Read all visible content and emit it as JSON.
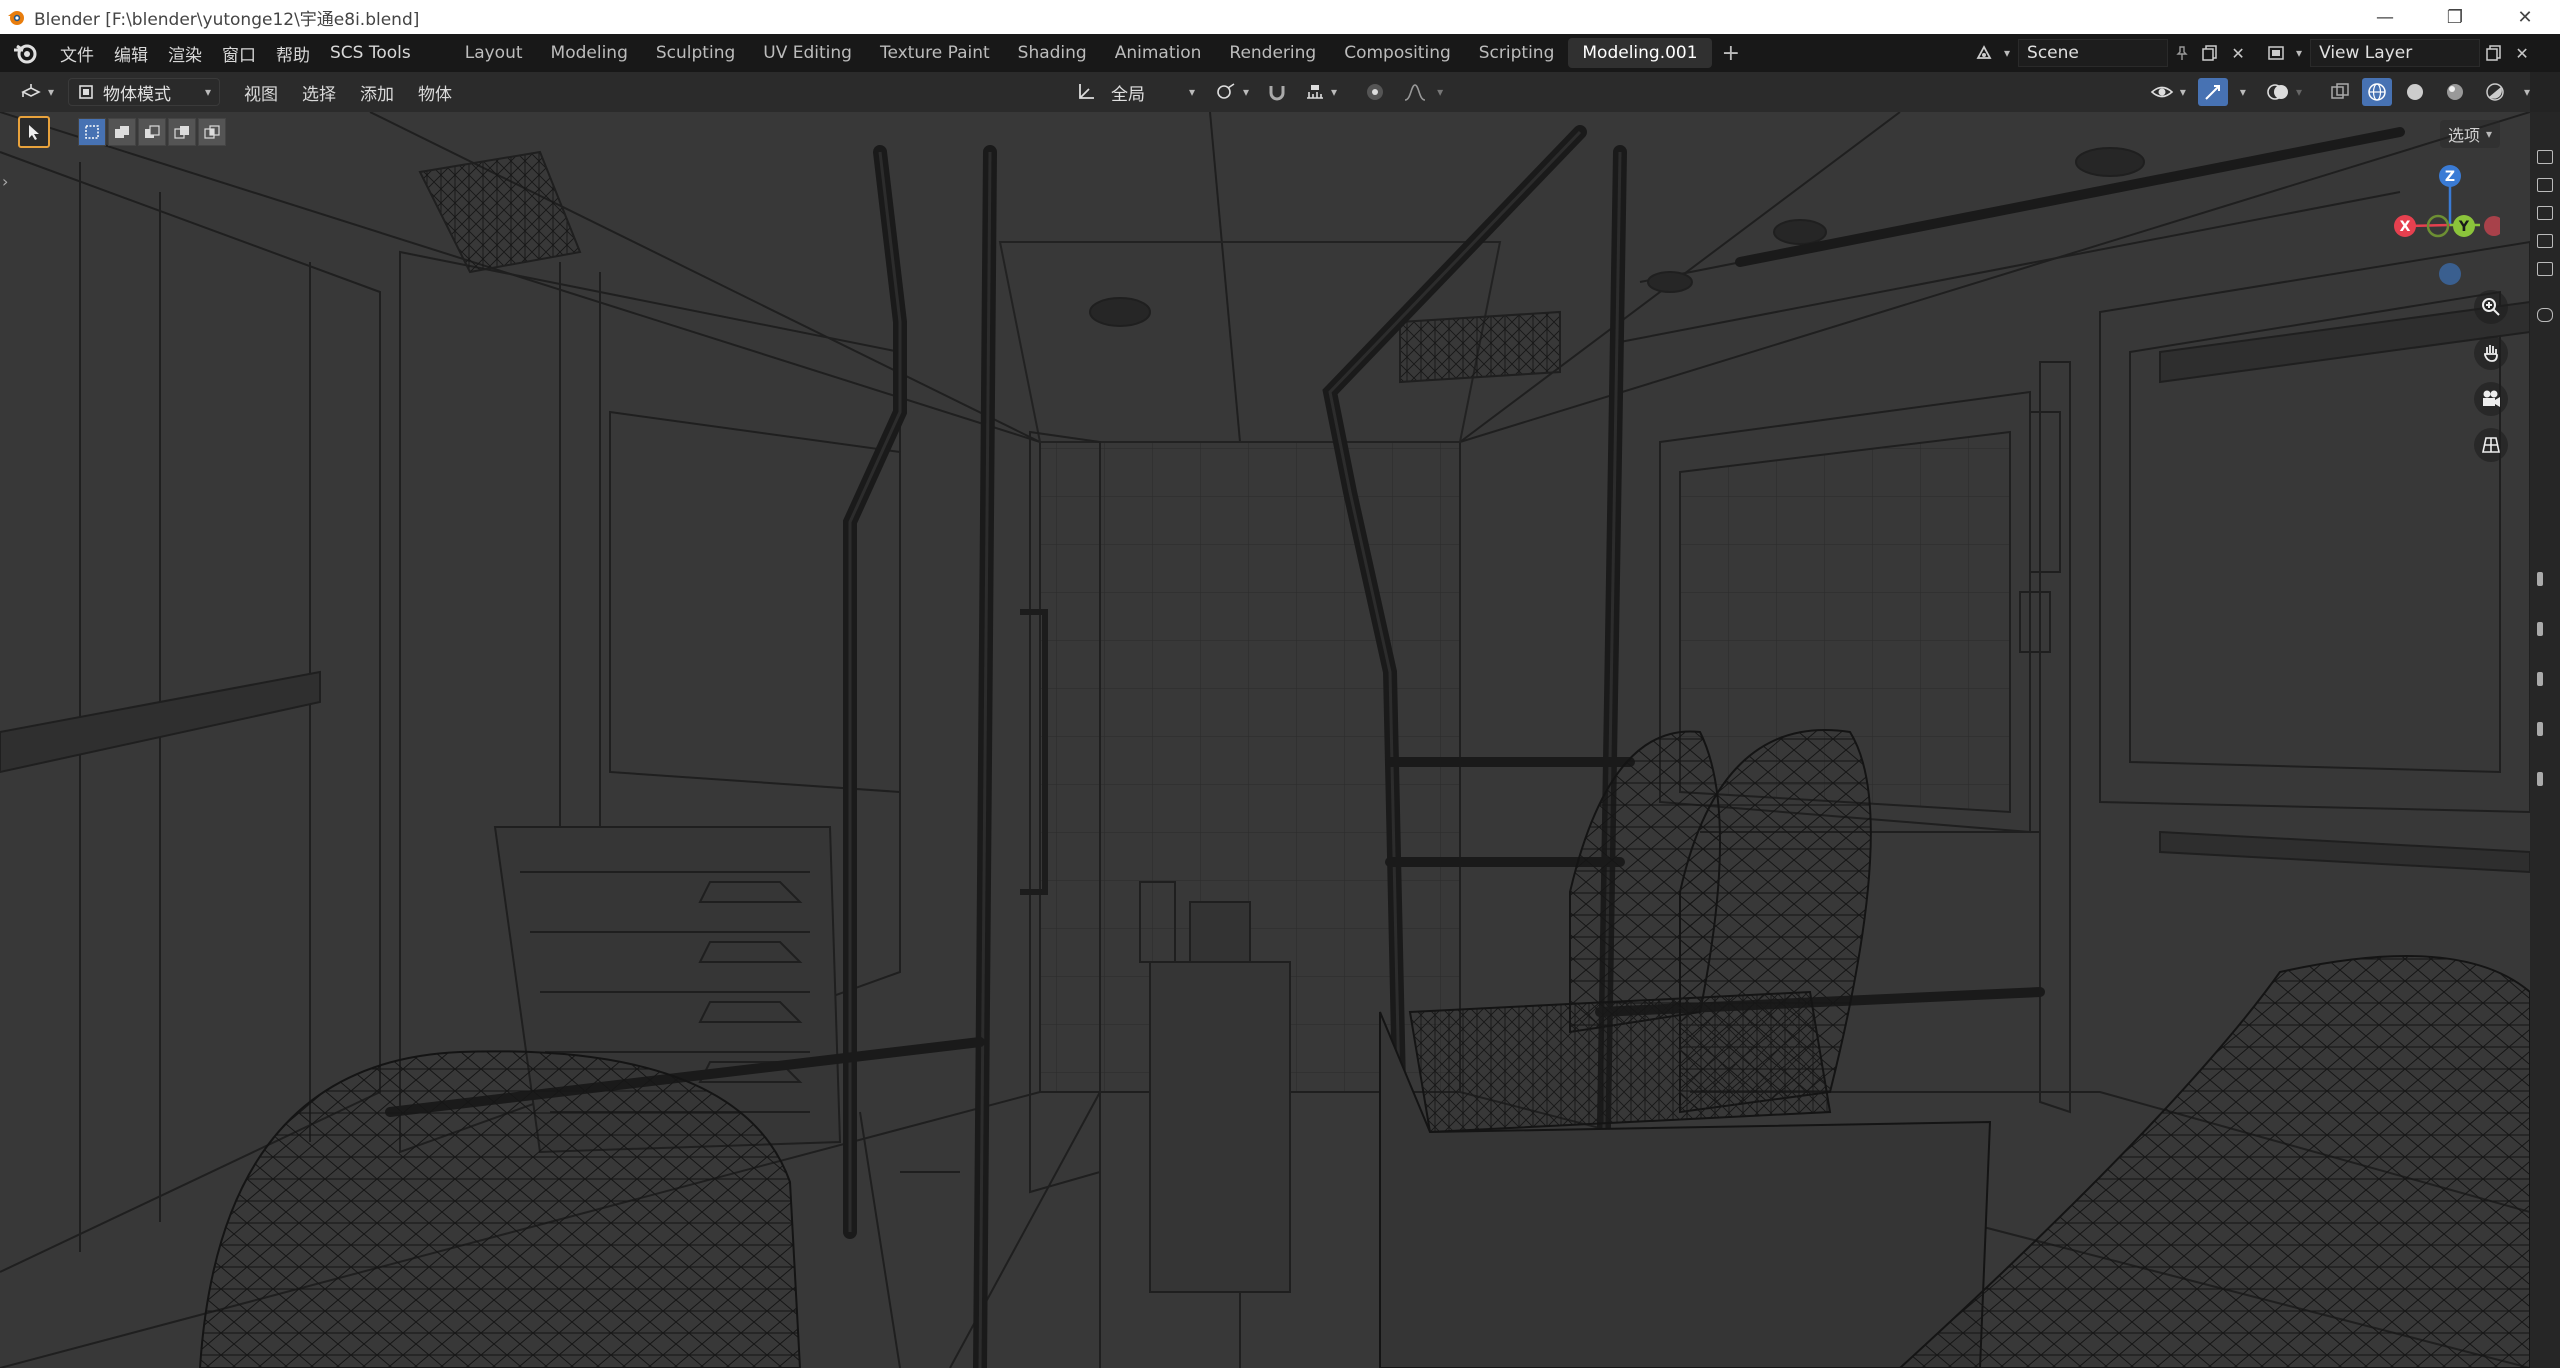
{
  "window": {
    "title": "Blender [F:\\blender\\yutonge12\\宇通e8i.blend]"
  },
  "menus": [
    "文件",
    "编辑",
    "渲染",
    "窗口",
    "帮助",
    "SCS Tools"
  ],
  "workspaces": [
    {
      "label": "Layout",
      "active": false
    },
    {
      "label": "Modeling",
      "active": false
    },
    {
      "label": "Sculpting",
      "active": false
    },
    {
      "label": "UV Editing",
      "active": false
    },
    {
      "label": "Texture Paint",
      "active": false
    },
    {
      "label": "Shading",
      "active": false
    },
    {
      "label": "Animation",
      "active": false
    },
    {
      "label": "Rendering",
      "active": false
    },
    {
      "label": "Compositing",
      "active": false
    },
    {
      "label": "Scripting",
      "active": false
    },
    {
      "label": "Modeling.001",
      "active": true
    }
  ],
  "scene": {
    "name": "Scene"
  },
  "view_layer": {
    "name": "View Layer"
  },
  "viewport_header": {
    "mode": "物体模式",
    "menus": [
      "视图",
      "选择",
      "添加",
      "物体"
    ],
    "transform_orientation": "全局"
  },
  "viewport": {
    "options_label": "选项",
    "gizmo": {
      "x": "X",
      "y": "Y",
      "z": "Z"
    }
  },
  "colors": {
    "accent": "#4772b3",
    "active_tool": "#e8a23c",
    "axis_x": "#e6404f",
    "axis_y": "#8bc43b",
    "axis_z": "#3a7bd5"
  }
}
